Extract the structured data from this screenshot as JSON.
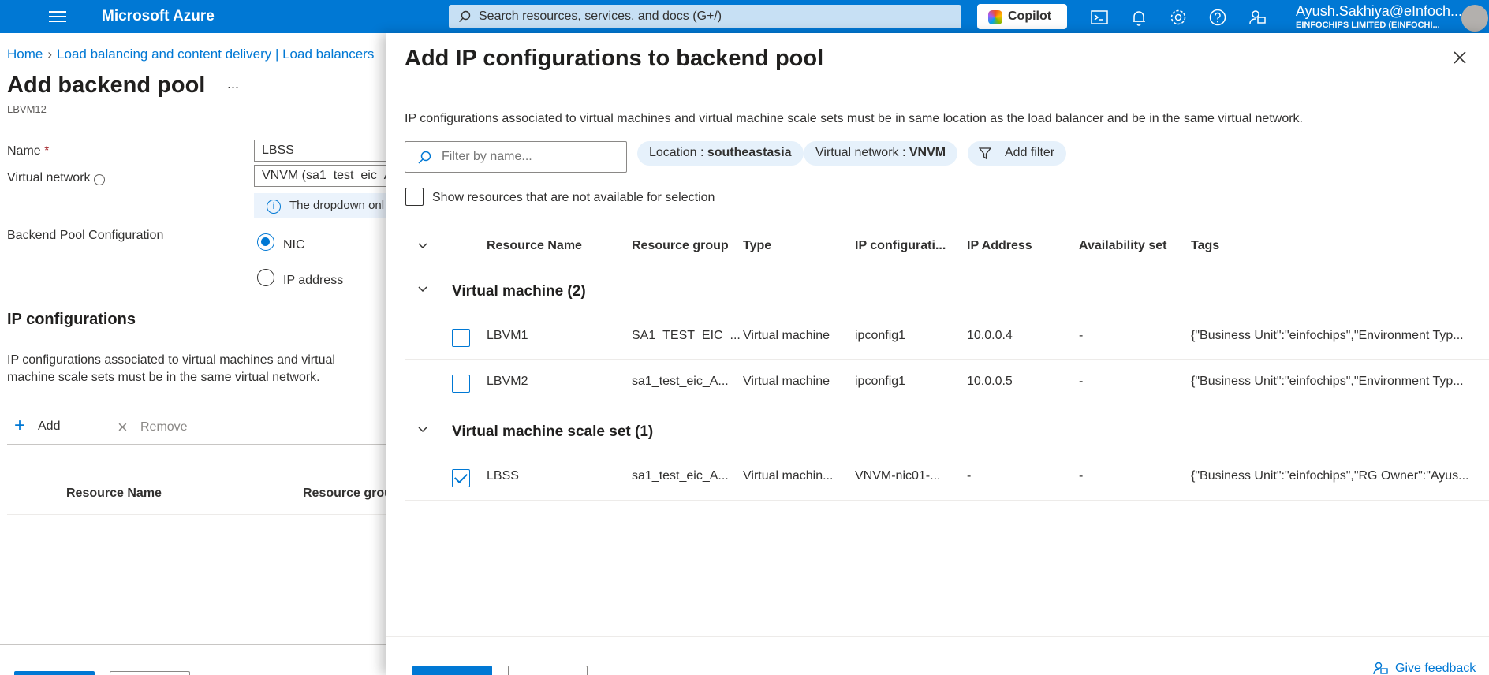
{
  "topbar": {
    "brand": "Microsoft Azure",
    "search_placeholder": "Search resources, services, and docs (G+/)",
    "copilot_label": "Copilot",
    "user_name": "Ayush.Sakhiya@eInfoch...",
    "user_org": "EINFOCHIPS LIMITED (EINFOCHI...",
    "icons": [
      "menu-icon",
      "search-icon",
      "cloud-shell-icon",
      "notifications-icon",
      "settings-icon",
      "help-icon",
      "feedback-icon",
      "avatar"
    ]
  },
  "breadcrumb": [
    "Home",
    "Load balancing and content delivery | Load balancers"
  ],
  "page": {
    "title": "Add backend pool",
    "more": "...",
    "subtitle": "LBVM12",
    "name_label": "Name",
    "name_required": "*",
    "name_value": "LBSS",
    "vnet_label": "Virtual network",
    "vnet_value": "VNVM (sa1_test_eic_A",
    "info_text": "The dropdown onl",
    "config_label": "Backend Pool Configuration",
    "option_nic": "NIC",
    "option_ip": "IP address",
    "ip_section_title": "IP configurations",
    "ip_desc": "IP configurations associated to virtual machines and virtual machine scale sets must be in the same virtual network.",
    "add_label": "Add",
    "remove_label": "Remove",
    "col_resource_name": "Resource Name",
    "col_resource_group": "Resource grou"
  },
  "blade": {
    "title": "Add IP configurations to backend pool",
    "description": "IP configurations associated to virtual machines and virtual machine scale sets must be in same location as the load balancer and be in the same virtual network.",
    "filter_placeholder": "Filter by name...",
    "location_label": "Location : ",
    "location_value": "southeastasia",
    "vnet_label": "Virtual network : ",
    "vnet_value": "VNVM",
    "add_filter": "Add filter",
    "show_unavailable": "Show resources that are not available for selection",
    "columns": [
      "Resource Name",
      "Resource group",
      "Type",
      "IP configurati...",
      "IP Address",
      "Availability set",
      "Tags"
    ],
    "groups": [
      {
        "title": "Virtual machine (2)",
        "rows": [
          {
            "name": "LBVM1",
            "group": "SA1_TEST_EIC_...",
            "type": "Virtual machine",
            "ipconfig": "ipconfig1",
            "ip": "10.0.0.4",
            "avset": "-",
            "tags": "{\"Business Unit\":\"einfochips\",\"Environment Typ...",
            "checked": false
          },
          {
            "name": "LBVM2",
            "group": "sa1_test_eic_A...",
            "type": "Virtual machine",
            "ipconfig": "ipconfig1",
            "ip": "10.0.0.5",
            "avset": "-",
            "tags": "{\"Business Unit\":\"einfochips\",\"Environment Typ...",
            "checked": false
          }
        ]
      },
      {
        "title": "Virtual machine scale set (1)",
        "rows": [
          {
            "name": "LBSS",
            "group": "sa1_test_eic_A...",
            "type": "Virtual machin...",
            "ipconfig": "VNVM-nic01-...",
            "ip": "-",
            "avset": "-",
            "tags": "{\"Business Unit\":\"einfochips\",\"RG Owner\":\"Ayus...",
            "checked": true
          }
        ]
      }
    ],
    "feedback": "Give feedback"
  },
  "colors": {
    "accent": "#0078d4",
    "topbar": "#0078d4",
    "search_bg": "#c7e0f4",
    "pill_bg": "#e6f1fb"
  }
}
